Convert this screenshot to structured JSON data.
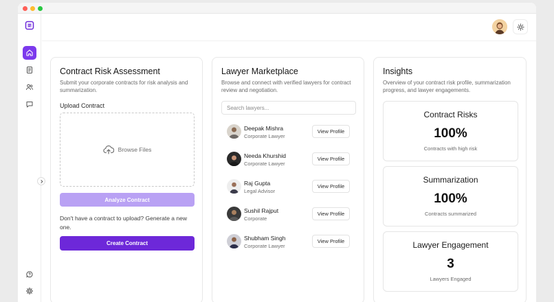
{
  "window": {
    "controls": [
      "close",
      "minimize",
      "maximize"
    ]
  },
  "sidebar": {
    "logo": "app-logo-icon",
    "items": [
      {
        "id": "home",
        "icon": "home-icon",
        "active": true
      },
      {
        "id": "documents",
        "icon": "document-icon",
        "active": false
      },
      {
        "id": "users",
        "icon": "users-icon",
        "active": false
      },
      {
        "id": "chat",
        "icon": "chat-icon",
        "active": false
      }
    ],
    "bottom_items": [
      {
        "id": "help",
        "icon": "help-icon"
      },
      {
        "id": "settings",
        "icon": "gear-icon"
      }
    ],
    "collapse_icon": "chevron-right-icon"
  },
  "header": {
    "avatar": "user-avatar",
    "theme_icon": "sun-icon"
  },
  "contract": {
    "title": "Contract Risk Assessment",
    "description": "Submit your corporate contracts for risk analysis and summarization.",
    "upload_label": "Upload Contract",
    "browse_label": "Browse Files",
    "analyze_label": "Analyze Contract",
    "generate_text": "Don't have a contract to upload? Generate a new one.",
    "create_label": "Create Contract"
  },
  "marketplace": {
    "title": "Lawyer Marketplace",
    "description": "Browse and connect with verified lawyers for contract review and negotiation.",
    "search_placeholder": "Search lawyers...",
    "view_label": "View Profile",
    "lawyers": [
      {
        "name": "Deepak Mishra",
        "role": "Corporate Lawyer"
      },
      {
        "name": "Needa Khurshid",
        "role": "Corporate Lawyer"
      },
      {
        "name": "Raj Gupta",
        "role": "Legal Advisor"
      },
      {
        "name": "Sushil Rajput",
        "role": "Corporate"
      },
      {
        "name": "Shubham Singh",
        "role": "Corporate Lawyer"
      }
    ]
  },
  "insights": {
    "title": "Insights",
    "description": "Overview of your contract risk profile, summarization progress, and lawyer engagements.",
    "stats": [
      {
        "title": "Contract Risks",
        "value": "100%",
        "subtitle": "Contracts with high risk"
      },
      {
        "title": "Summarization",
        "value": "100%",
        "subtitle": "Contracts summarized"
      },
      {
        "title": "Lawyer Engagement",
        "value": "3",
        "subtitle": "Lawyers Engaged"
      }
    ]
  },
  "colors": {
    "accent": "#7c3aed",
    "accent_dark": "#6d28d9",
    "accent_light": "#b9a1f4"
  }
}
